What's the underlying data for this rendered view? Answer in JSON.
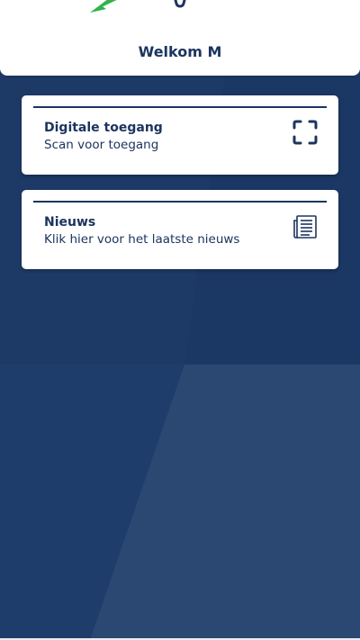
{
  "header": {
    "welcome_text": "Welkom M"
  },
  "cards": {
    "digital_access": {
      "title": "Digitale toegang",
      "subtitle": "Scan voor toegang",
      "icon": "scan-icon"
    },
    "news": {
      "title": "Nieuws",
      "subtitle": "Klik hier voor het laatste nieuws",
      "icon": "newspaper-icon"
    }
  },
  "colors": {
    "primary": "#1c3560",
    "background": "#1f3d6b",
    "accent_green": "#2fb34a",
    "card": "#ffffff"
  }
}
